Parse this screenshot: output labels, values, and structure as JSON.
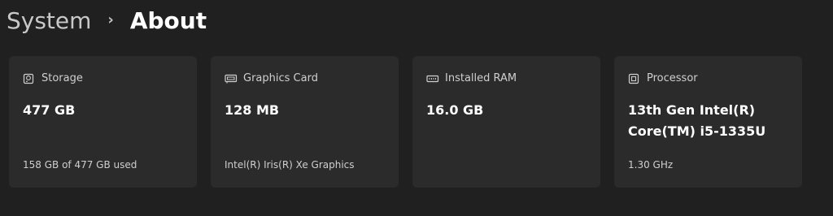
{
  "breadcrumb": {
    "parent": "System",
    "separator": "›",
    "current": "About"
  },
  "cards": [
    {
      "label": "Storage",
      "icon": "storage-icon",
      "value": "477 GB",
      "subtext": "158 GB of 477 GB used"
    },
    {
      "label": "Graphics Card",
      "icon": "graphics-card-icon",
      "value": "128 MB",
      "subtext": "Intel(R) Iris(R) Xe Graphics"
    },
    {
      "label": "Installed RAM",
      "icon": "ram-icon",
      "value": "16.0 GB",
      "subtext": ""
    },
    {
      "label": "Processor",
      "icon": "processor-icon",
      "value": "13th Gen Intel(R) Core(TM) i5-1335U",
      "subtext": "1.30 GHz"
    }
  ],
  "colors": {
    "background": "#202020",
    "card": "#2b2b2b",
    "text_primary": "#ffffff",
    "text_secondary": "#cfcfcf"
  }
}
